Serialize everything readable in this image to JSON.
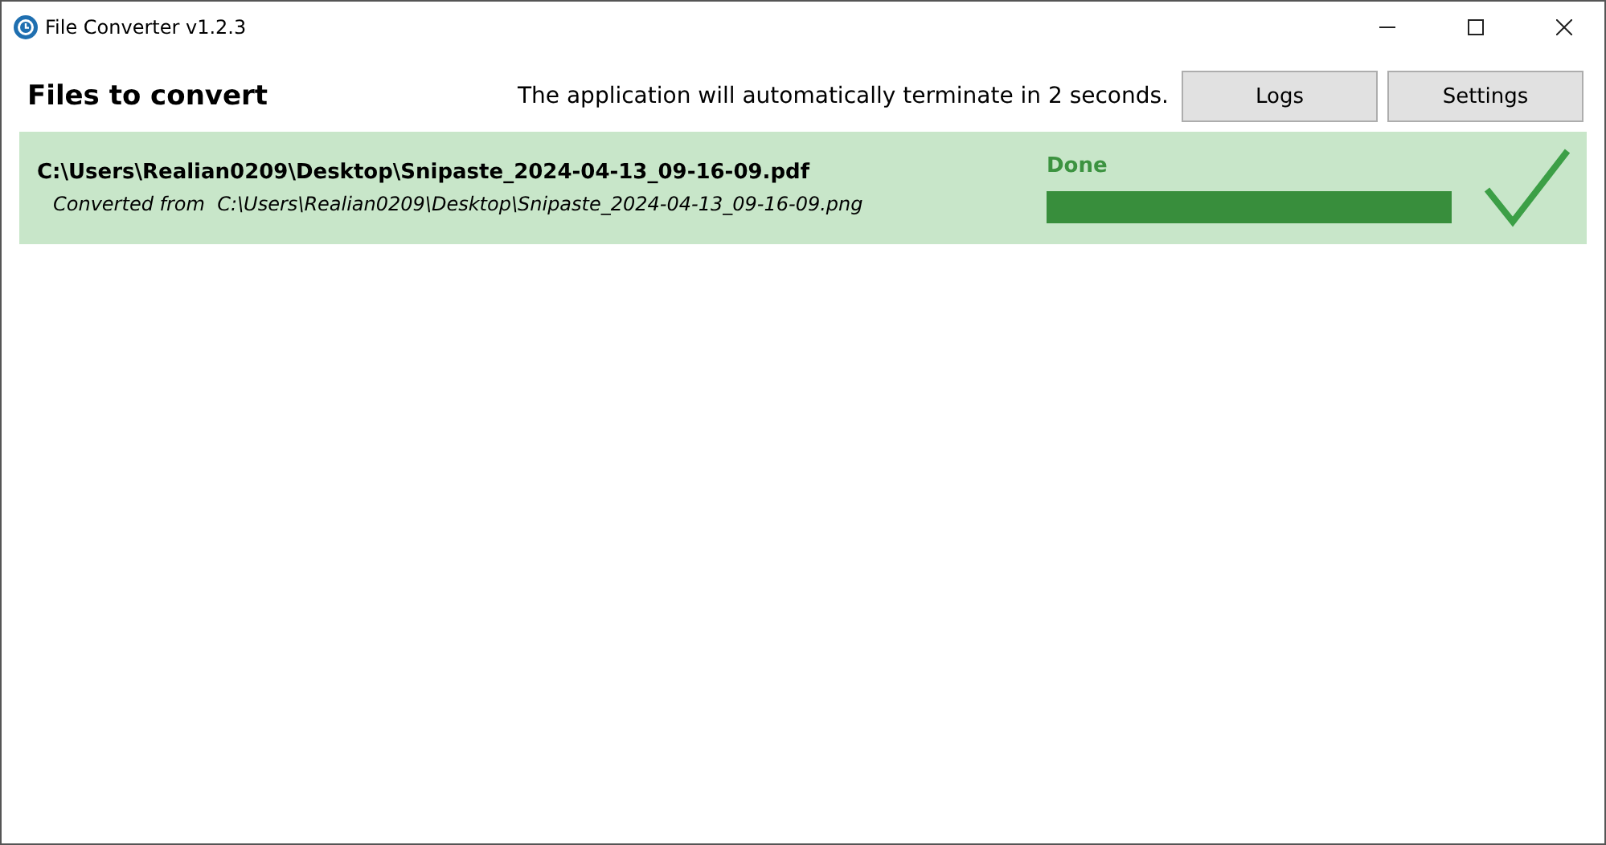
{
  "window": {
    "title": "File Converter v1.2.3"
  },
  "header": {
    "title": "Files to convert",
    "message": "The application will automatically terminate in 2 seconds.",
    "buttons": [
      "Logs",
      "Settings"
    ]
  },
  "files": [
    {
      "output_path": "C:\\Users\\Realian0209\\Desktop\\Snipaste_2024-04-13_09-16-09.pdf",
      "source": "Converted from  C:\\Users\\Realian0209\\Desktop\\Snipaste_2024-04-13_09-16-09.png",
      "status": "Done",
      "kind": "done",
      "level": 1
    }
  ]
}
